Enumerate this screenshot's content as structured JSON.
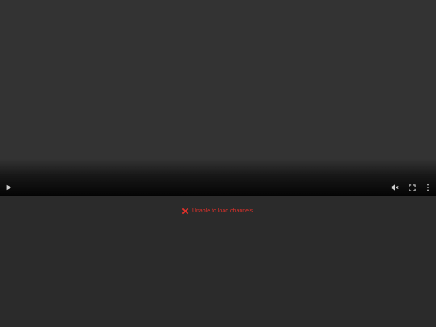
{
  "player": {
    "controls": {
      "play_icon": "play-icon",
      "mute_icon": "volume-muted-icon",
      "fullscreen_icon": "fullscreen-icon",
      "more_icon": "more-vertical-icon"
    }
  },
  "status": {
    "error_icon": "cross-icon",
    "error_message": "Unable to load channels.",
    "error_color": "#e0312b"
  },
  "colors": {
    "page_background": "#2b2b2b",
    "video_background": "#333333",
    "control_icon": "#cfcfcf"
  }
}
